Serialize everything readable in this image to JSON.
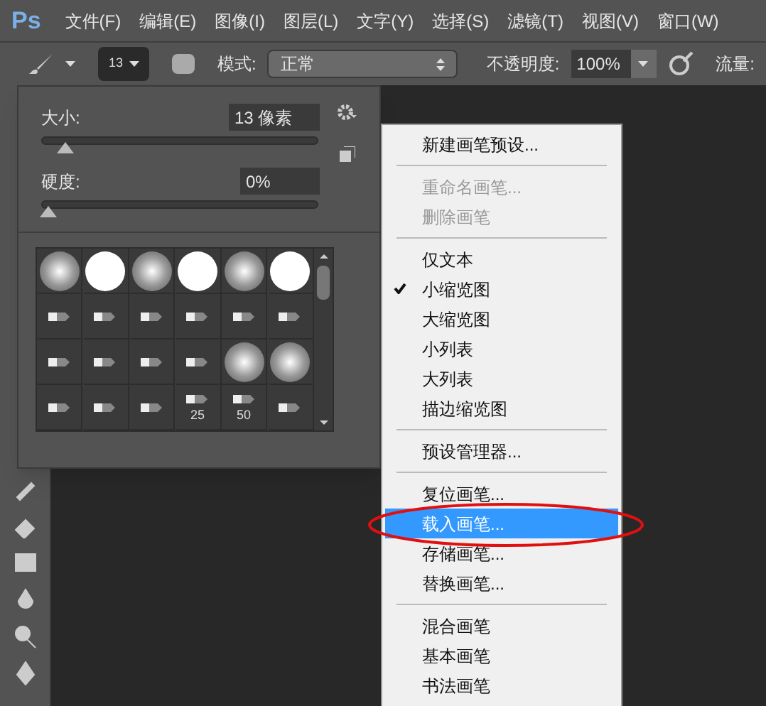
{
  "app_logo": "Ps",
  "menu_bar": [
    "文件(F)",
    "编辑(E)",
    "图像(I)",
    "图层(L)",
    "文字(Y)",
    "选择(S)",
    "滤镜(T)",
    "视图(V)",
    "窗口(W)"
  ],
  "options_bar": {
    "brush_size": "13",
    "mode_label": "模式:",
    "mode_value": "正常",
    "opacity_label": "不透明度:",
    "opacity_value": "100%",
    "flow_label": "流量:"
  },
  "brush_panel": {
    "size_label": "大小:",
    "size_value": "13 像素",
    "size_slider": {
      "level": 0.06
    },
    "hardness_label": "硬度:",
    "hardness_value": "0%",
    "hardness_slider": {
      "level": 0
    },
    "presets": [
      {
        "kind": "soft"
      },
      {
        "kind": "hard"
      },
      {
        "kind": "soft"
      },
      {
        "kind": "hard"
      },
      {
        "kind": "soft"
      },
      {
        "kind": "hard"
      },
      {
        "kind": "tip"
      },
      {
        "kind": "tip"
      },
      {
        "kind": "tip"
      },
      {
        "kind": "tip"
      },
      {
        "kind": "tip"
      },
      {
        "kind": "tip"
      },
      {
        "kind": "tip"
      },
      {
        "kind": "tip"
      },
      {
        "kind": "tip"
      },
      {
        "kind": "tip"
      },
      {
        "kind": "soft"
      },
      {
        "kind": "soft"
      },
      {
        "kind": "tip"
      },
      {
        "kind": "tip"
      },
      {
        "kind": "tip"
      },
      {
        "kind": "tip",
        "label": "25"
      },
      {
        "kind": "tip",
        "label": "50"
      },
      {
        "kind": "tip"
      }
    ]
  },
  "context_menu": [
    {
      "kind": "item",
      "label": "新建画笔预设...",
      "disabled": false,
      "checked": false,
      "selected": false
    },
    {
      "kind": "separator"
    },
    {
      "kind": "item",
      "label": "重命名画笔...",
      "disabled": true,
      "checked": false,
      "selected": false
    },
    {
      "kind": "item",
      "label": "删除画笔",
      "disabled": true,
      "checked": false,
      "selected": false
    },
    {
      "kind": "separator"
    },
    {
      "kind": "item",
      "label": "仅文本",
      "disabled": false,
      "checked": false,
      "selected": false
    },
    {
      "kind": "item",
      "label": "小缩览图",
      "disabled": false,
      "checked": true,
      "selected": false
    },
    {
      "kind": "item",
      "label": "大缩览图",
      "disabled": false,
      "checked": false,
      "selected": false
    },
    {
      "kind": "item",
      "label": "小列表",
      "disabled": false,
      "checked": false,
      "selected": false
    },
    {
      "kind": "item",
      "label": "大列表",
      "disabled": false,
      "checked": false,
      "selected": false
    },
    {
      "kind": "item",
      "label": "描边缩览图",
      "disabled": false,
      "checked": false,
      "selected": false
    },
    {
      "kind": "separator"
    },
    {
      "kind": "item",
      "label": "预设管理器...",
      "disabled": false,
      "checked": false,
      "selected": false
    },
    {
      "kind": "separator"
    },
    {
      "kind": "item",
      "label": "复位画笔...",
      "disabled": false,
      "checked": false,
      "selected": false
    },
    {
      "kind": "item",
      "label": "载入画笔...",
      "disabled": false,
      "checked": false,
      "selected": true
    },
    {
      "kind": "item",
      "label": "存储画笔...",
      "disabled": false,
      "checked": false,
      "selected": false
    },
    {
      "kind": "item",
      "label": "替换画笔...",
      "disabled": false,
      "checked": false,
      "selected": false
    },
    {
      "kind": "separator"
    },
    {
      "kind": "item",
      "label": "混合画笔",
      "disabled": false,
      "checked": false,
      "selected": false
    },
    {
      "kind": "item",
      "label": "基本画笔",
      "disabled": false,
      "checked": false,
      "selected": false
    },
    {
      "kind": "item",
      "label": "书法画笔",
      "disabled": false,
      "checked": false,
      "selected": false
    }
  ]
}
